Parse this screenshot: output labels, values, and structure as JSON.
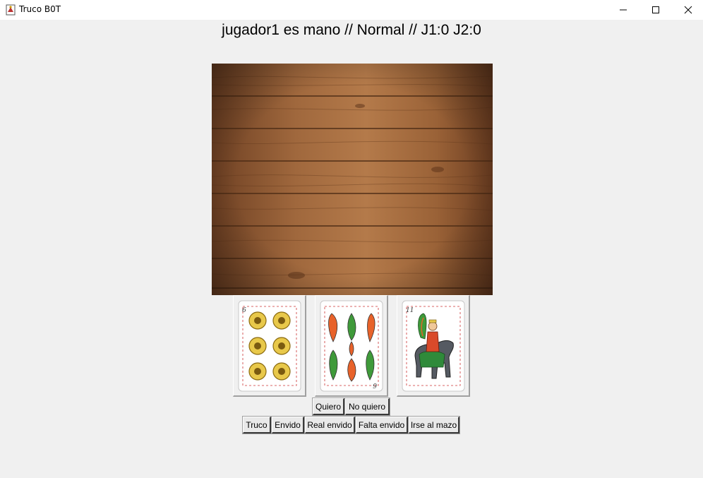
{
  "window": {
    "title": "Truco B0T",
    "icon": "app-icon",
    "controls": [
      "minimize-icon",
      "maximize-icon",
      "close-icon"
    ]
  },
  "status_text": "jugador1 es mano // Normal // J1:0 J2:0",
  "table": {
    "image": "wood-table"
  },
  "hand": [
    {
      "rank": "6",
      "suit": "oros"
    },
    {
      "rank": "9",
      "suit": "espadas"
    },
    {
      "rank": "11",
      "suit": "bastos"
    }
  ],
  "response_buttons": {
    "quiero": "Quiero",
    "no_quiero": "No quiero"
  },
  "action_buttons": {
    "truco": "Truco",
    "envido": "Envido",
    "real_envido": "Real envido",
    "falta_envido": "Falta envido",
    "irse_al_mazo": "Irse al mazo"
  },
  "colors": {
    "background": "#f0f0f0",
    "wood": "#8b5a34",
    "gold_coin": "#e8c84a"
  }
}
